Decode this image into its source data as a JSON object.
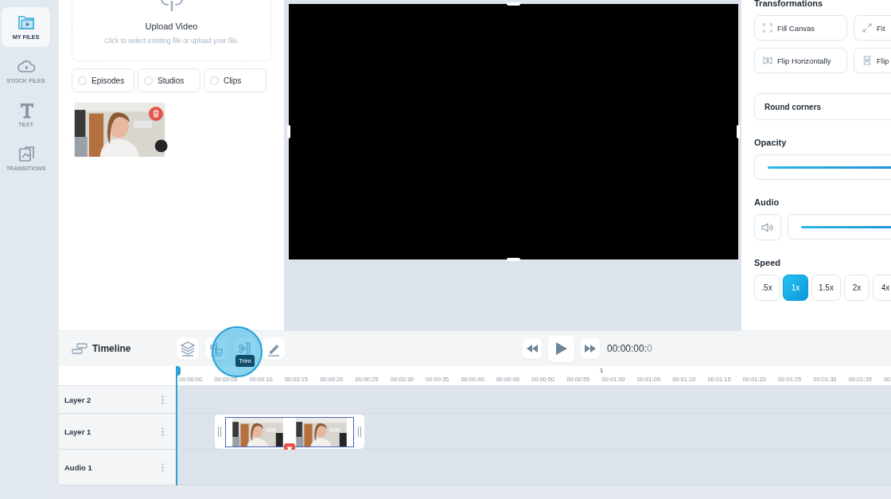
{
  "nav": [
    {
      "label": "MY FILES",
      "selected": true
    },
    {
      "label": "STOCK FILES",
      "selected": false
    },
    {
      "label": "TEXT",
      "selected": false
    },
    {
      "label": "TRANSITIONS",
      "selected": false
    }
  ],
  "upload": {
    "title": "Upload Video",
    "hint": "Click to select existing file or upload your file."
  },
  "filters": [
    {
      "label": "Episodes",
      "selected": false
    },
    {
      "label": "Studios",
      "selected": false
    },
    {
      "label": "Clips",
      "selected": false
    }
  ],
  "properties": {
    "transformations": {
      "title": "Transformations",
      "buttons": [
        {
          "label": "Fill Canvas"
        },
        {
          "label": "Fit"
        },
        {
          "label": "Flip Horizontally"
        },
        {
          "label": "Flip"
        }
      ]
    },
    "round_corners": {
      "label": "Round corners"
    },
    "opacity": {
      "label": "Opacity",
      "level": 1
    },
    "audio": {
      "label": "Audio",
      "level": 1
    },
    "speed": {
      "label": "Speed",
      "options": [
        {
          "label": ".5x",
          "selected": false
        },
        {
          "label": "1x",
          "selected": true
        },
        {
          "label": "1.5x",
          "selected": false
        },
        {
          "label": "2x",
          "selected": false
        },
        {
          "label": "4x",
          "selected": false
        }
      ]
    }
  },
  "timeline": {
    "title": "Timeline",
    "tools": [
      {
        "kind": "layers"
      },
      {
        "kind": "split"
      },
      {
        "kind": "trim",
        "tooltip": "Trim"
      },
      {
        "kind": "edit"
      }
    ],
    "time": "00:00:00:",
    "frame": "0",
    "marker": "1",
    "ruler": [
      "00:00:00",
      "00:00:05",
      "00:00:10",
      "00:00:15",
      "00:00:20",
      "00:00:25",
      "00:00:30",
      "00:00:35",
      "00:00:40",
      "00:00:45",
      "00:00:50",
      "00:00:55",
      "00:01:00",
      "00:01:05",
      "00:01:10",
      "00:01:15",
      "00:01:20",
      "00:01:25",
      "00:01:30",
      "00:01:35",
      "00:"
    ],
    "rows": [
      {
        "name": "Layer 2"
      },
      {
        "name": "Layer 1"
      },
      {
        "name": "Audio 1"
      }
    ]
  }
}
